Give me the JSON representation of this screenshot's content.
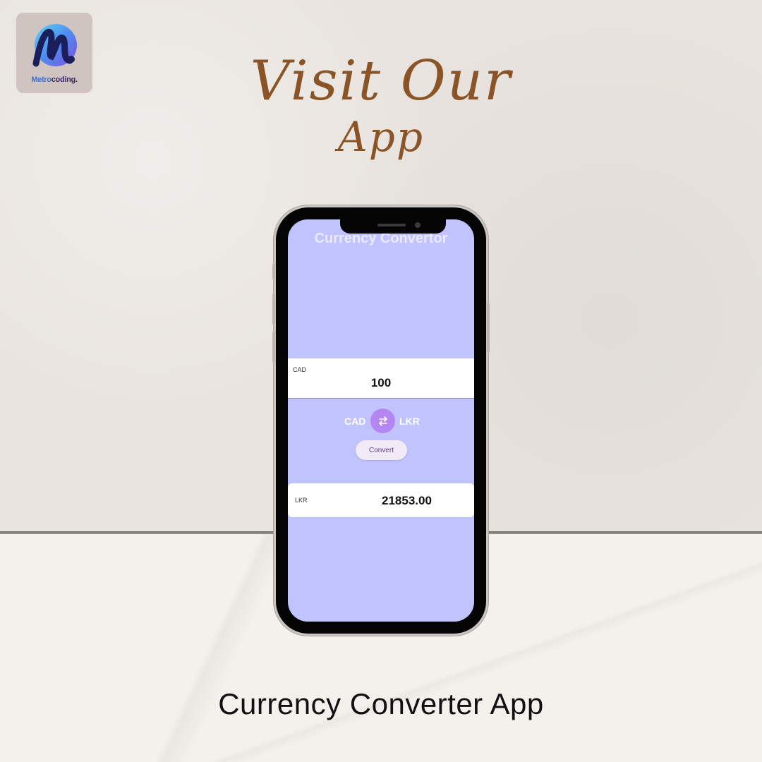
{
  "logo": {
    "text_part1": "Metro",
    "text_part2": "coding."
  },
  "heading": {
    "line1": "Visit Our",
    "line2": "App"
  },
  "phone_app": {
    "title": "Currency Convertor",
    "from_card": {
      "code": "CAD",
      "amount": "100"
    },
    "swap_row": {
      "from_currency": "CAD",
      "to_currency": "LKR",
      "swap_icon": "swap-arrows-icon"
    },
    "convert_button": "Convert",
    "to_card": {
      "code": "LKR",
      "amount": "21853.00"
    },
    "colors": {
      "screen_bg": "#c1c3ff",
      "swap_button": "#b486f2",
      "convert_button_bg": "#f2eaf7"
    }
  },
  "caption": "Currency Converter App",
  "colors": {
    "heading": "#8a5427",
    "wall": "#e8e3de",
    "floor": "#f4f1ed"
  }
}
